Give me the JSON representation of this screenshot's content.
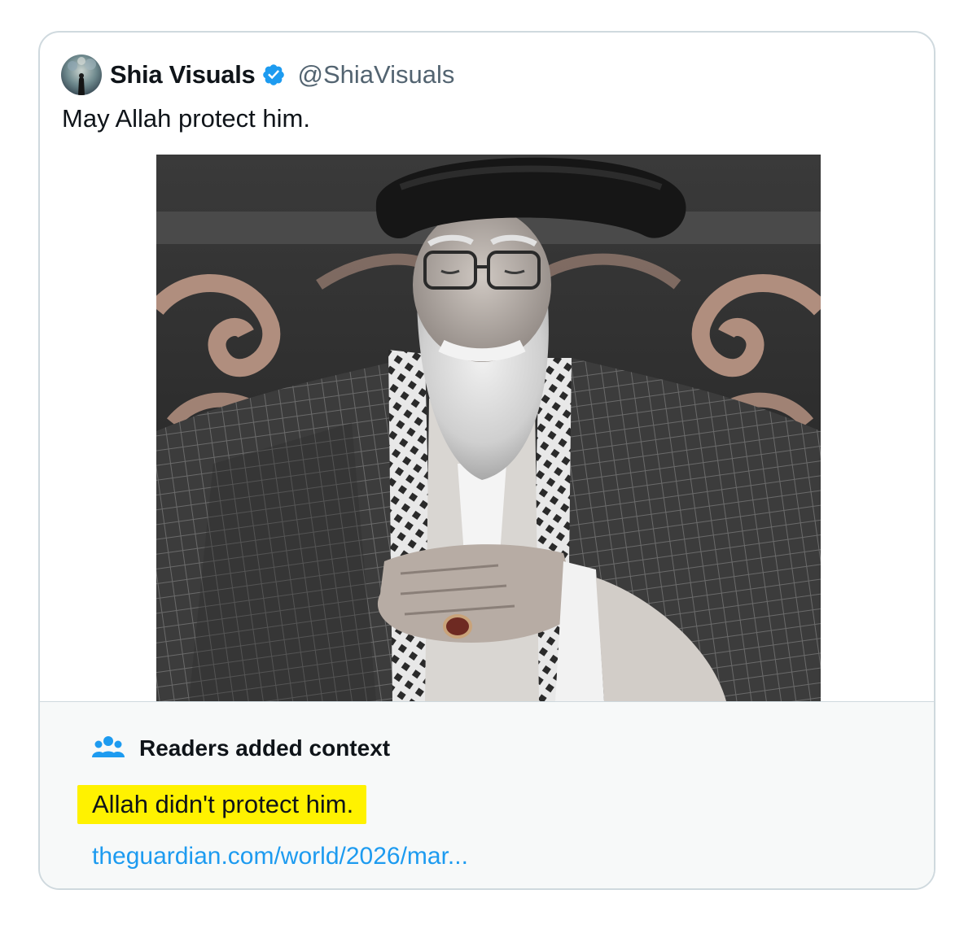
{
  "tweet": {
    "display_name": "Shia Visuals",
    "handle": "@ShiaVisuals",
    "text": "May Allah protect him.",
    "verified": true,
    "avatar_icon": "avatar-icon",
    "verified_icon": "verified-badge-icon"
  },
  "community_note": {
    "title": "Readers added context",
    "icon": "people-icon",
    "note_text": "Allah didn't protect him.",
    "link_text": "theguardian.com/world/2026/mar..."
  },
  "colors": {
    "text_primary": "#0f1419",
    "text_secondary": "#536471",
    "link": "#1d9bf0",
    "highlight": "#fff200",
    "note_background": "#f7f9f9",
    "border": "#cfd9de"
  }
}
